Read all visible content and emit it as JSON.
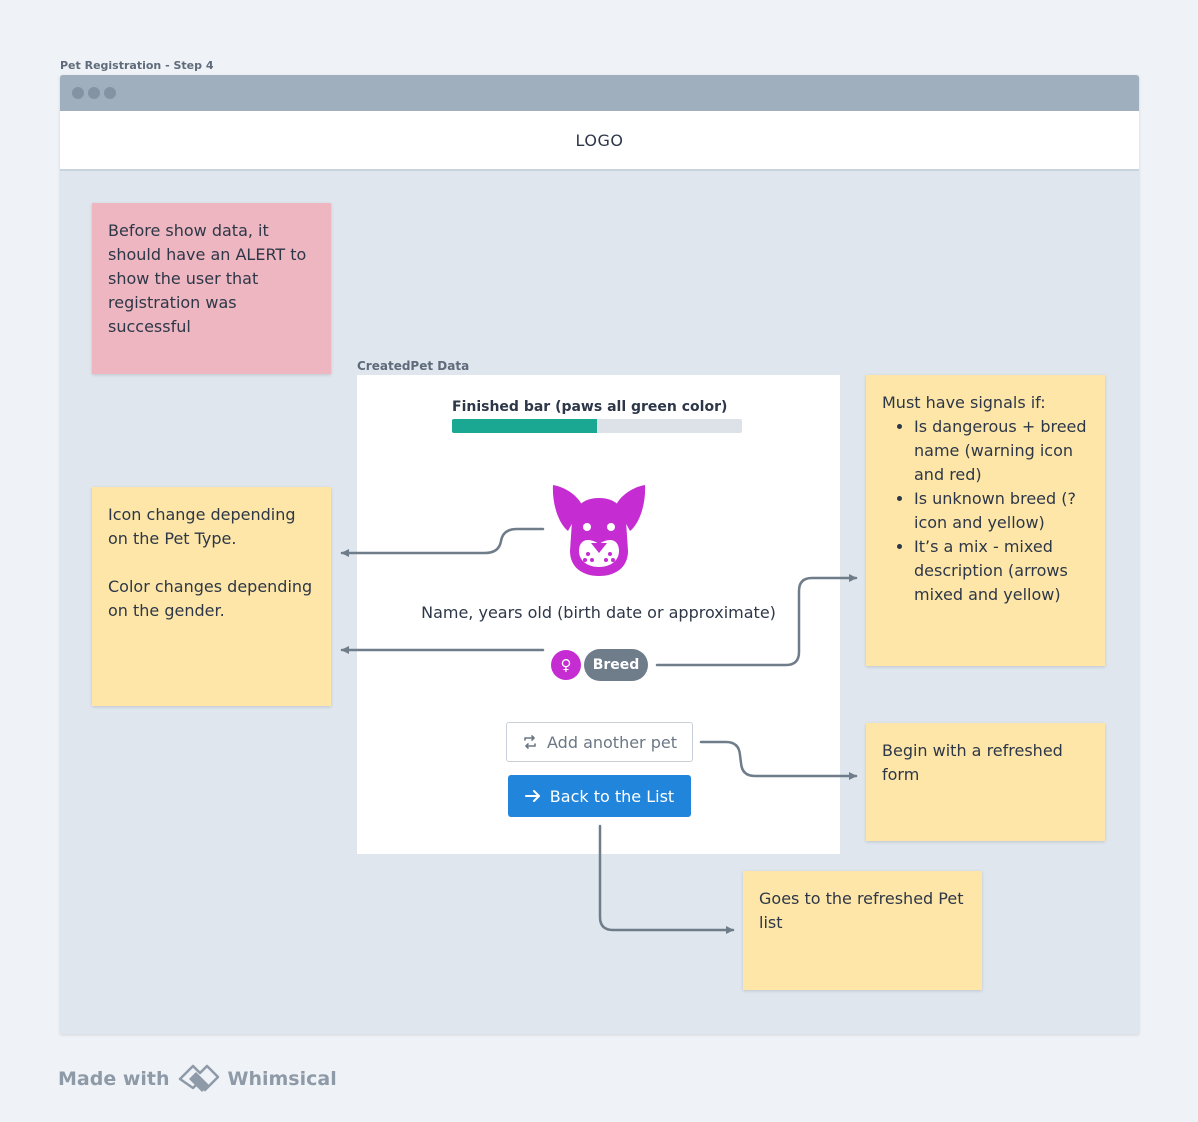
{
  "frame": {
    "title": "Pet Registration - Step 4"
  },
  "header": {
    "logo": "LOGO"
  },
  "notes": {
    "alert": "Before show data, it should have an ALERT to show the user that registration was successful",
    "icon_line1": "Icon change depending on the Pet Type.",
    "icon_line2": "Color changes depending on the gender.",
    "signals_intro": "Must have signals if:",
    "signals_items": [
      "Is dangerous + breed name (warning icon and red)",
      "Is unknown breed (? icon and yellow)",
      "It’s a mix - mixed description (arrows mixed and yellow)"
    ],
    "refresh_form": "Begin with a refreshed form",
    "refresh_list": "Goes to the refreshed Pet list"
  },
  "card": {
    "label": "CreatedPet Data",
    "progress_title": "Finished bar (paws all green color)",
    "progress_fraction": 0.5,
    "pet_icon": "dog-face-icon",
    "caption": "Name, years old (birth date or approximate)",
    "gender_symbol": "♀",
    "gender_icon": "female-icon",
    "breed": "Breed",
    "add_another_label": "Add another pet",
    "back_label": "Back to the List"
  },
  "colors": {
    "progress": "#1aa893",
    "pet_female": "#c52cd1",
    "primary_button": "#2185dc",
    "note_pink": "#edb6c0",
    "note_yellow": "#fde6a7"
  },
  "footer": {
    "made_with": "Made with",
    "brand": "Whimsical"
  }
}
